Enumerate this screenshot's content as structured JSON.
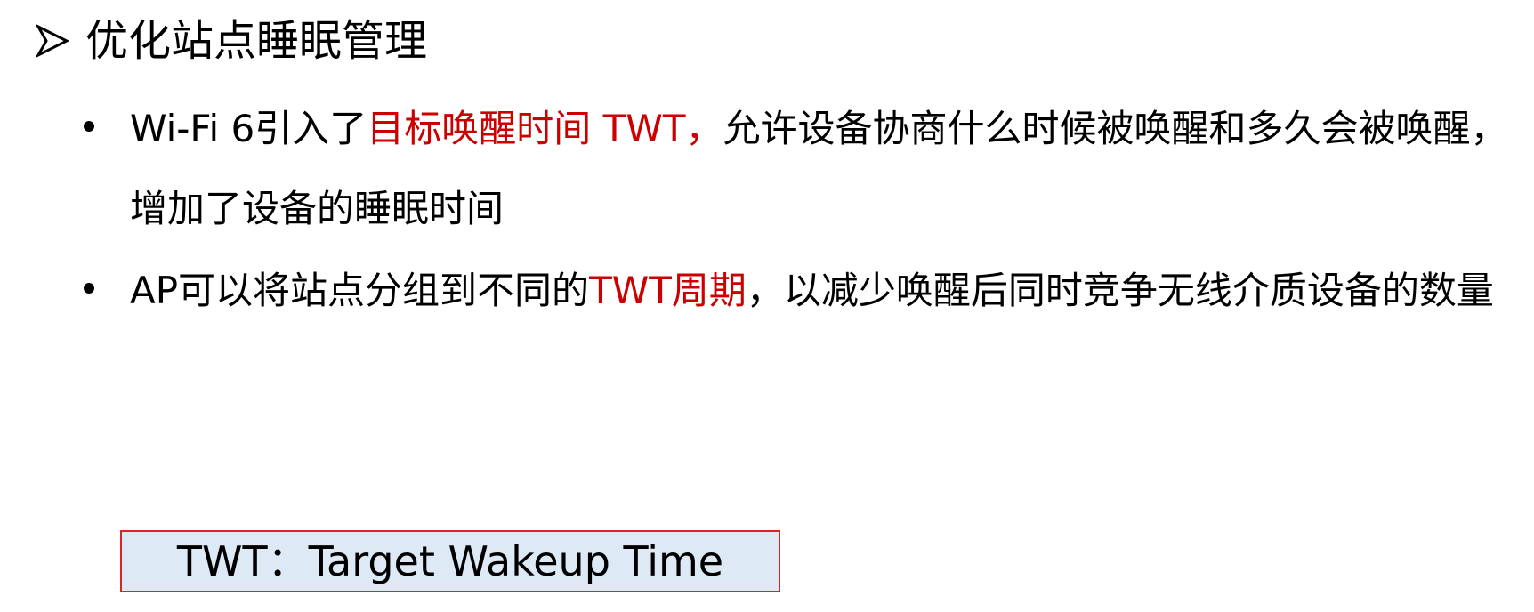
{
  "heading": {
    "icon": "arrowhead-bullet-icon",
    "title": "优化站点睡眠管理"
  },
  "bullets": [
    {
      "prefix": "Wi-Fi 6引入了",
      "highlight": "目标唤醒时间 TWT，",
      "suffix": "允许设备协商什么时候被唤醒和多久会被唤醒，增加了设备的睡眠时间"
    },
    {
      "prefix": "AP可以将站点分组到不同的",
      "highlight": "TWT周期",
      "suffix": "，以减少唤醒后同时竞争无线介质设备的数量"
    }
  ],
  "definition_box": {
    "text": "TWT：Target Wakeup Time"
  },
  "colors": {
    "text": "#000000",
    "highlight": "#cc0000",
    "box_fill": "#dde9f5",
    "box_border": "#d9252a"
  }
}
